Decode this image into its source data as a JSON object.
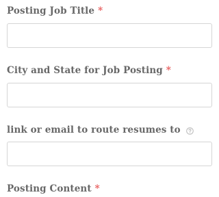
{
  "form": {
    "required_marker": "*",
    "fields": [
      {
        "label": "Posting Job Title",
        "required": true,
        "value": ""
      },
      {
        "label": "City and State for Job Posting",
        "required": true,
        "value": ""
      },
      {
        "label": "link or email to route resumes to",
        "required": false,
        "help_icon": "question-circle-icon",
        "value": ""
      },
      {
        "label": "Posting Content",
        "required": true
      }
    ]
  },
  "colors": {
    "label": "#686868",
    "required": "#e85d5d",
    "input_border": "#d5d5d5",
    "help_icon": "#b8b8b8"
  }
}
